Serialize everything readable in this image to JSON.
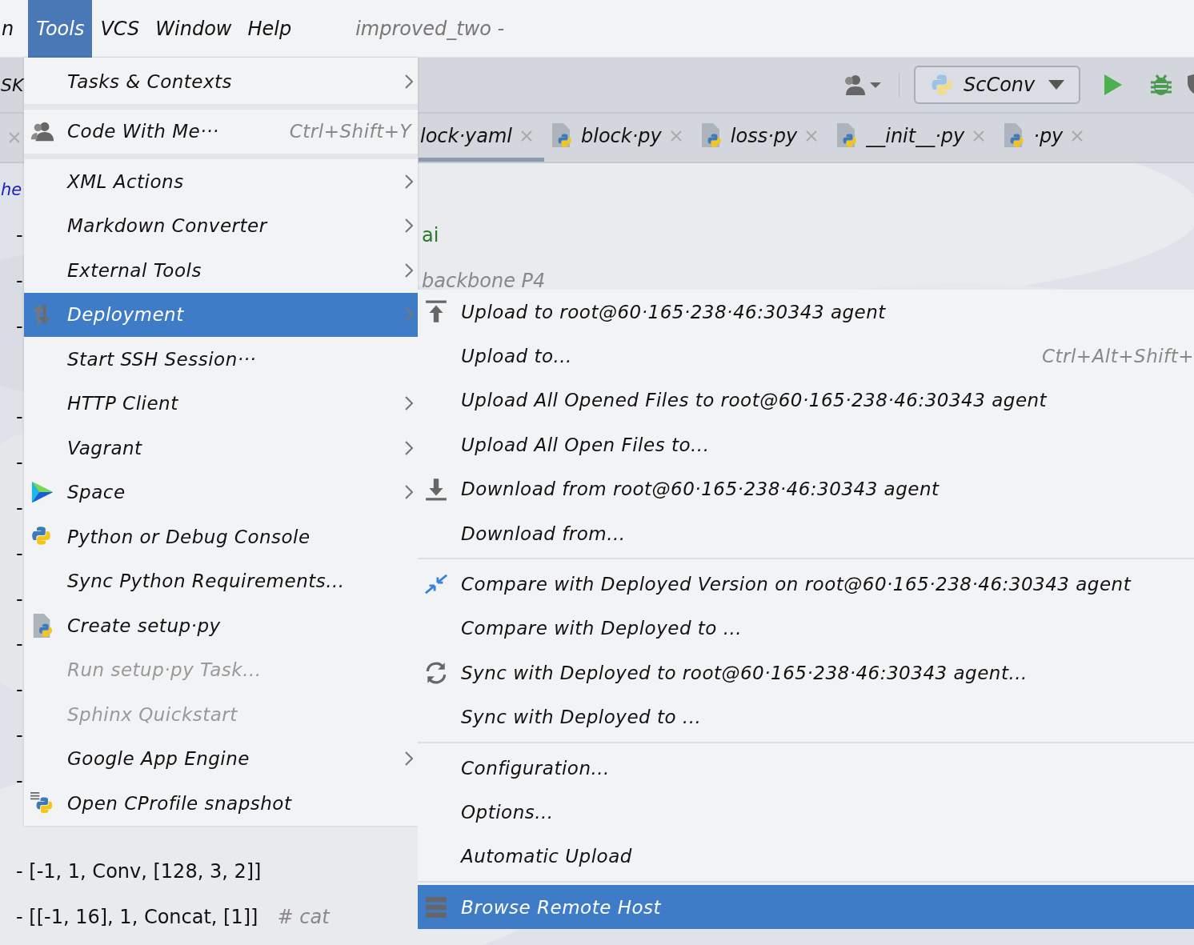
{
  "menubar": {
    "items": [
      {
        "label": "n",
        "selected": false
      },
      {
        "label": "Tools",
        "selected": true
      },
      {
        "label": "VCS",
        "selected": false
      },
      {
        "label": "Window",
        "selected": false
      },
      {
        "label": "Help",
        "selected": false
      }
    ],
    "title": "improved_two -"
  },
  "toolbar": {
    "left_text": "SK",
    "run_config": "ScConv"
  },
  "tabs": [
    {
      "label": "lock·yaml",
      "selected": true,
      "kind": "plain"
    },
    {
      "label": "block·py",
      "selected": false,
      "kind": "python"
    },
    {
      "label": "loss·py",
      "selected": false,
      "kind": "python"
    },
    {
      "label": "__init__·py",
      "selected": false,
      "kind": "python"
    },
    {
      "label": "·py",
      "selected": false,
      "kind": "python"
    }
  ],
  "editor": {
    "lines": [
      {
        "kind": "keyword",
        "text": "he"
      },
      {
        "kind": "code",
        "text": "-",
        "tail": {
          "text": "ai",
          "kind": "string"
        }
      },
      {
        "kind": "code",
        "text": "-",
        "tail": {
          "text": "backbone P4",
          "kind": "comment"
        }
      },
      {
        "kind": "code",
        "text": "-"
      },
      {
        "kind": "blank"
      },
      {
        "kind": "code",
        "text": "-"
      },
      {
        "kind": "code",
        "text": "-"
      },
      {
        "kind": "code",
        "text": "-"
      },
      {
        "kind": "code",
        "text": "-"
      },
      {
        "kind": "code",
        "text": "-"
      },
      {
        "kind": "code",
        "text": "-"
      },
      {
        "kind": "code",
        "text": "-"
      },
      {
        "kind": "code",
        "text": "-"
      },
      {
        "kind": "code",
        "text": "-"
      },
      {
        "kind": "blank"
      },
      {
        "kind": "code",
        "text": "- [-1, 1, Conv, [128, 3, 2]]"
      },
      {
        "kind": "code",
        "text": "- [[-1, 16], 1, Concat, [1]]",
        "comment": "# cat"
      }
    ]
  },
  "tools_menu": {
    "items": [
      {
        "kind": "plain",
        "label": "Tasks & Contexts",
        "submenu": true,
        "selected": false,
        "disabled": false
      },
      {
        "kind": "separator"
      },
      {
        "kind": "people",
        "label": "Code With Me···",
        "shortcut": "Ctrl+Shift+Y",
        "submenu": false,
        "selected": false,
        "disabled": false
      },
      {
        "kind": "separator"
      },
      {
        "kind": "plain",
        "label": "XML Actions",
        "submenu": true,
        "selected": false,
        "disabled": false
      },
      {
        "kind": "plain",
        "label": "Markdown Converter",
        "submenu": true,
        "selected": false,
        "disabled": false
      },
      {
        "kind": "plain",
        "label": "External Tools",
        "submenu": true,
        "selected": false,
        "disabled": false
      },
      {
        "kind": "arrows",
        "label": "Deployment",
        "submenu": true,
        "selected": true,
        "disabled": false
      },
      {
        "kind": "plain",
        "label": "Start SSH Session···",
        "submenu": false,
        "selected": false,
        "disabled": false
      },
      {
        "kind": "plain",
        "label": "HTTP Client",
        "submenu": true,
        "selected": false,
        "disabled": false
      },
      {
        "kind": "plain",
        "label": "Vagrant",
        "submenu": true,
        "selected": false,
        "disabled": false
      },
      {
        "kind": "space",
        "label": "Space",
        "submenu": true,
        "selected": false,
        "disabled": false
      },
      {
        "kind": "python",
        "label": "Python or Debug Console",
        "submenu": false,
        "selected": false,
        "disabled": false
      },
      {
        "kind": "plain",
        "label": "Sync Python Requirements...",
        "submenu": false,
        "selected": false,
        "disabled": false
      },
      {
        "kind": "pyfile",
        "label": "Create setup·py",
        "submenu": false,
        "selected": false,
        "disabled": false
      },
      {
        "kind": "plain",
        "label": "Run setup·py Task...",
        "submenu": false,
        "selected": false,
        "disabled": true
      },
      {
        "kind": "plain",
        "label": "Sphinx Quickstart",
        "submenu": false,
        "selected": false,
        "disabled": true
      },
      {
        "kind": "plain",
        "label": "Google App Engine",
        "submenu": true,
        "selected": false,
        "disabled": false
      },
      {
        "kind": "profile",
        "label": "Open CProfile snapshot",
        "submenu": false,
        "selected": false,
        "disabled": false
      }
    ]
  },
  "deployment_menu": {
    "items": [
      {
        "kind": "upload",
        "label": "Upload to root@60·165·238·46:30343 agent",
        "selected": false
      },
      {
        "kind": "plain",
        "label": "Upload to...",
        "shortcut": "Ctrl+Alt+Shift+",
        "selected": false
      },
      {
        "kind": "plain",
        "label": "Upload All Opened Files to root@60·165·238·46:30343 agent",
        "selected": false
      },
      {
        "kind": "plain",
        "label": "Upload All Open Files to...",
        "selected": false
      },
      {
        "kind": "download",
        "label": "Download from root@60·165·238·46:30343 agent",
        "selected": false
      },
      {
        "kind": "plain",
        "label": "Download from...",
        "selected": false
      },
      {
        "kind": "separator"
      },
      {
        "kind": "compare",
        "label": "Compare with Deployed Version on root@60·165·238·46:30343 agent",
        "selected": false
      },
      {
        "kind": "plain",
        "label": "Compare with Deployed to ...",
        "selected": false
      },
      {
        "kind": "sync",
        "label": "Sync with Deployed to root@60·165·238·46:30343 agent...",
        "selected": false
      },
      {
        "kind": "plain",
        "label": "Sync with Deployed to ...",
        "selected": false
      },
      {
        "kind": "separator"
      },
      {
        "kind": "plain",
        "label": "Configuration...",
        "selected": false
      },
      {
        "kind": "plain",
        "label": "Options...",
        "selected": false
      },
      {
        "kind": "plain",
        "label": "Automatic Upload",
        "selected": false
      },
      {
        "kind": "separator"
      },
      {
        "kind": "server",
        "label": "Browse Remote Host",
        "selected": true
      }
    ]
  }
}
